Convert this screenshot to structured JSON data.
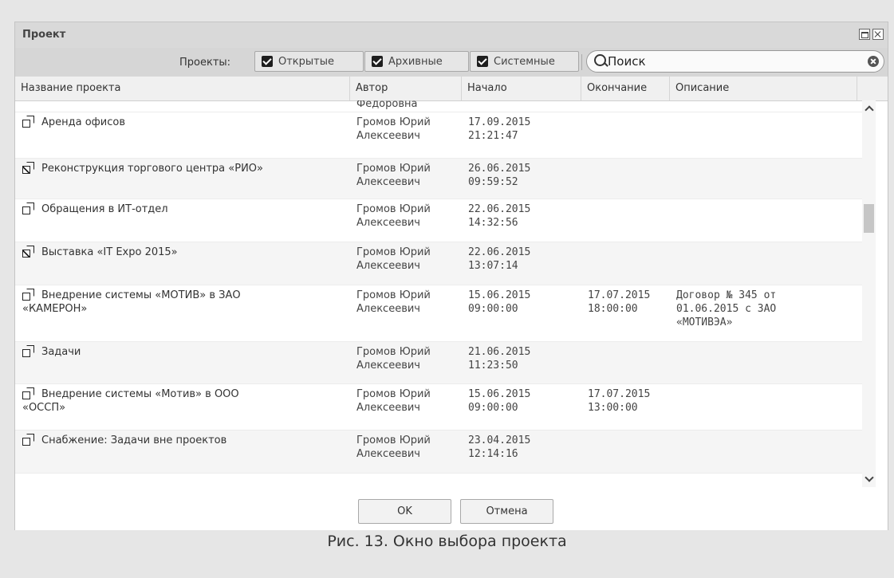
{
  "window": {
    "title": "Проект"
  },
  "toolbar": {
    "projects_label": "Проекты:",
    "filters": {
      "open": "Открытые",
      "archive": "Архивные",
      "system": "Системные"
    },
    "search_placeholder": "Поиск"
  },
  "columns": {
    "name": "Название проекта",
    "author": "Автор",
    "start": "Начало",
    "end": "Окончание",
    "description": "Описание"
  },
  "partial_row": {
    "author_tail": "Федоровна"
  },
  "rows": [
    {
      "name": "Аренда офисов",
      "icon": "project-open-icon",
      "author": "Громов Юрий Алексеевич",
      "start_date": "17.09.2015",
      "start_time": "21:21:47",
      "end_date": "",
      "end_time": "",
      "description": ""
    },
    {
      "name": "Реконструкция торгового центра «РИО»",
      "icon": "project-archive-icon",
      "author": "Громов Юрий Алексеевич",
      "start_date": "26.06.2015",
      "start_time": "09:59:52",
      "end_date": "",
      "end_time": "",
      "description": ""
    },
    {
      "name": "Обращения в ИТ-отдел",
      "icon": "project-open-icon",
      "author": "Громов Юрий Алексеевич",
      "start_date": "22.06.2015",
      "start_time": "14:32:56",
      "end_date": "",
      "end_time": "",
      "description": ""
    },
    {
      "name": "Выставка «IT Expo 2015»",
      "icon": "project-archive-icon",
      "author": "Громов Юрий Алексеевич",
      "start_date": "22.06.2015",
      "start_time": "13:07:14",
      "end_date": "",
      "end_time": "",
      "description": ""
    },
    {
      "name": "Внедрение системы «МОТИВ» в ЗАО «КАМЕРОН»",
      "icon": "project-open-icon",
      "author": "Громов Юрий Алексеевич",
      "start_date": "15.06.2015",
      "start_time": "09:00:00",
      "end_date": "17.07.2015",
      "end_time": "18:00:00",
      "description": "Договор № 345 от 01.06.2015 с ЗАО «МОТИВЭА»"
    },
    {
      "name": "Задачи",
      "icon": "project-open-icon",
      "author": "Громов Юрий Алексеевич",
      "start_date": "21.06.2015",
      "start_time": "11:23:50",
      "end_date": "",
      "end_time": "",
      "description": ""
    },
    {
      "name": "Внедрение системы «Мотив» в ООО «ОССП»",
      "icon": "project-open-icon",
      "author": "Громов Юрий Алексеевич",
      "start_date": "15.06.2015",
      "start_time": "09:00:00",
      "end_date": "17.07.2015",
      "end_time": "13:00:00",
      "description": ""
    },
    {
      "name": "Снабжение: Задачи вне проектов",
      "icon": "project-open-icon",
      "author": "Громов Юрий Алексеевич",
      "start_date": "23.04.2015",
      "start_time": "12:14:16",
      "end_date": "",
      "end_time": "",
      "description": ""
    }
  ],
  "buttons": {
    "ok": "OK",
    "cancel": "Отмена"
  },
  "caption": "Рис. 13. Окно выбора проекта"
}
